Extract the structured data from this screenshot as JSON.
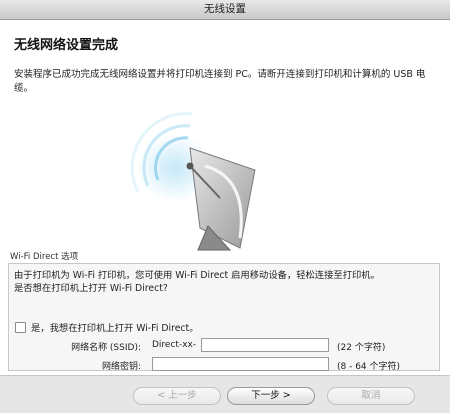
{
  "window": {
    "title": "无线设置"
  },
  "main": {
    "heading": "无线网络设置完成",
    "description": "安装程序已成功完成无线网络设置并将打印机连接到 PC。请断开连接到打印机和计算机的 USB 电缆。"
  },
  "wifi_direct": {
    "section_label": "Wi-Fi Direct 选项",
    "info_line1": "由于打印机为 Wi-Fi 打印机，您可使用 Wi-Fi Direct 启用移动设备，轻松连接至打印机。",
    "info_line2": "是否想在打印机上打开 Wi-Fi Direct?",
    "checkbox_label": "是，我想在打印机上打开 Wi-Fi Direct。",
    "checked": false,
    "ssid": {
      "label": "网络名称 (SSID):",
      "prefix": "Direct-xx-",
      "value": "",
      "hint": "(22 个字符)"
    },
    "key": {
      "label": "网络密钥:",
      "value": "",
      "hint": "(8 - 64 个字符)"
    }
  },
  "footer": {
    "back_label": "< 上一步",
    "next_label": "下一步 >",
    "cancel_label": "取消"
  }
}
